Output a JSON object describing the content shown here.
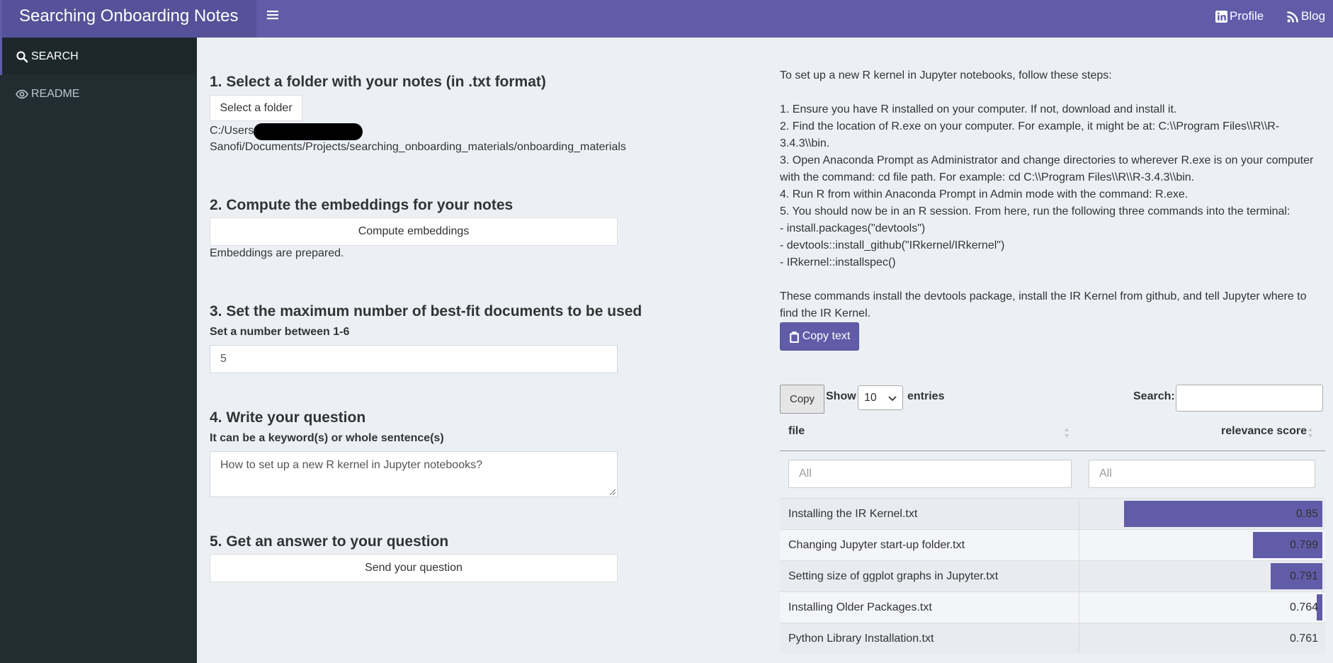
{
  "header": {
    "title": "Searching Onboarding Notes",
    "profile_label": "Profile",
    "blog_label": "Blog"
  },
  "sidebar": {
    "items": [
      {
        "label": "SEARCH",
        "icon": "search-icon"
      },
      {
        "label": "README",
        "icon": "eye-icon"
      }
    ]
  },
  "steps": {
    "folder": {
      "heading": "1. Select a folder with your notes (in .txt format)",
      "button": "Select a folder",
      "path_line1": "C:/Users/",
      "path_line2": "Sanofi/Documents/Projects/searching_onboarding_materials/onboarding_materials"
    },
    "embeddings": {
      "heading": "2. Compute the embeddings for your notes",
      "button": "Compute embeddings",
      "status": "Embeddings are prepared."
    },
    "max_docs": {
      "heading": "3. Set the maximum number of best-fit documents to be used",
      "label": "Set a number between 1-6",
      "value": "5"
    },
    "question": {
      "heading": "4. Write your question",
      "label": "It can be a keyword(s) or whole sentence(s)",
      "value": "How to set up a new R kernel in Jupyter notebooks?"
    },
    "answer": {
      "heading": "5. Get an answer to your question",
      "button": "Send your question"
    }
  },
  "answer_text": {
    "intro": "To set up a new R kernel in Jupyter notebooks, follow these steps:",
    "steps": [
      "1. Ensure you have R installed on your computer. If not, download and install it.",
      "2. Find the location of R.exe on your computer. For example, it might be at: C:\\\\Program Files\\\\R\\\\R-3.4.3\\\\bin.",
      "3. Open Anaconda Prompt as Administrator and change directories to wherever R.exe is on your computer with the command: cd file path. For example: cd C:\\\\Program Files\\\\R\\\\R-3.4.3\\\\bin.",
      "4. Run R from within Anaconda Prompt in Admin mode with the command: R.exe.",
      "5. You should now be in an R session. From here, run the following three commands into the terminal:",
      "- install.packages(\"devtools\")",
      "- devtools::install_github(\"IRkernel/IRkernel\")",
      "- IRkernel::installspec()"
    ],
    "outro": "These commands install the devtools package, install the IR Kernel from github, and tell Jupyter where to find the IR Kernel.",
    "copy_button": "Copy text"
  },
  "table": {
    "copy_button": "Copy",
    "show_label": "Show",
    "page_size": "10",
    "entries_label": "entries",
    "search_label": "Search:",
    "columns": [
      "file",
      "relevance score"
    ],
    "filter_placeholders": [
      "All",
      "All"
    ],
    "rows": [
      {
        "file": "Installing the IR Kernel.txt",
        "score": "0.85",
        "bar_fraction": 1.0
      },
      {
        "file": "Changing Jupyter start-up folder.txt",
        "score": "0.799",
        "bar_fraction": 0.35
      },
      {
        "file": "Setting size of ggplot graphs in Jupyter.txt",
        "score": "0.791",
        "bar_fraction": 0.26
      },
      {
        "file": "Installing Older Packages.txt",
        "score": "0.764",
        "bar_fraction": 0.03
      },
      {
        "file": "Python Library Installation.txt",
        "score": "0.761",
        "bar_fraction": 0.0
      }
    ]
  },
  "colors": {
    "accent": "#605ca8",
    "sidebar": "#222d32",
    "background": "#ecf0f5"
  }
}
